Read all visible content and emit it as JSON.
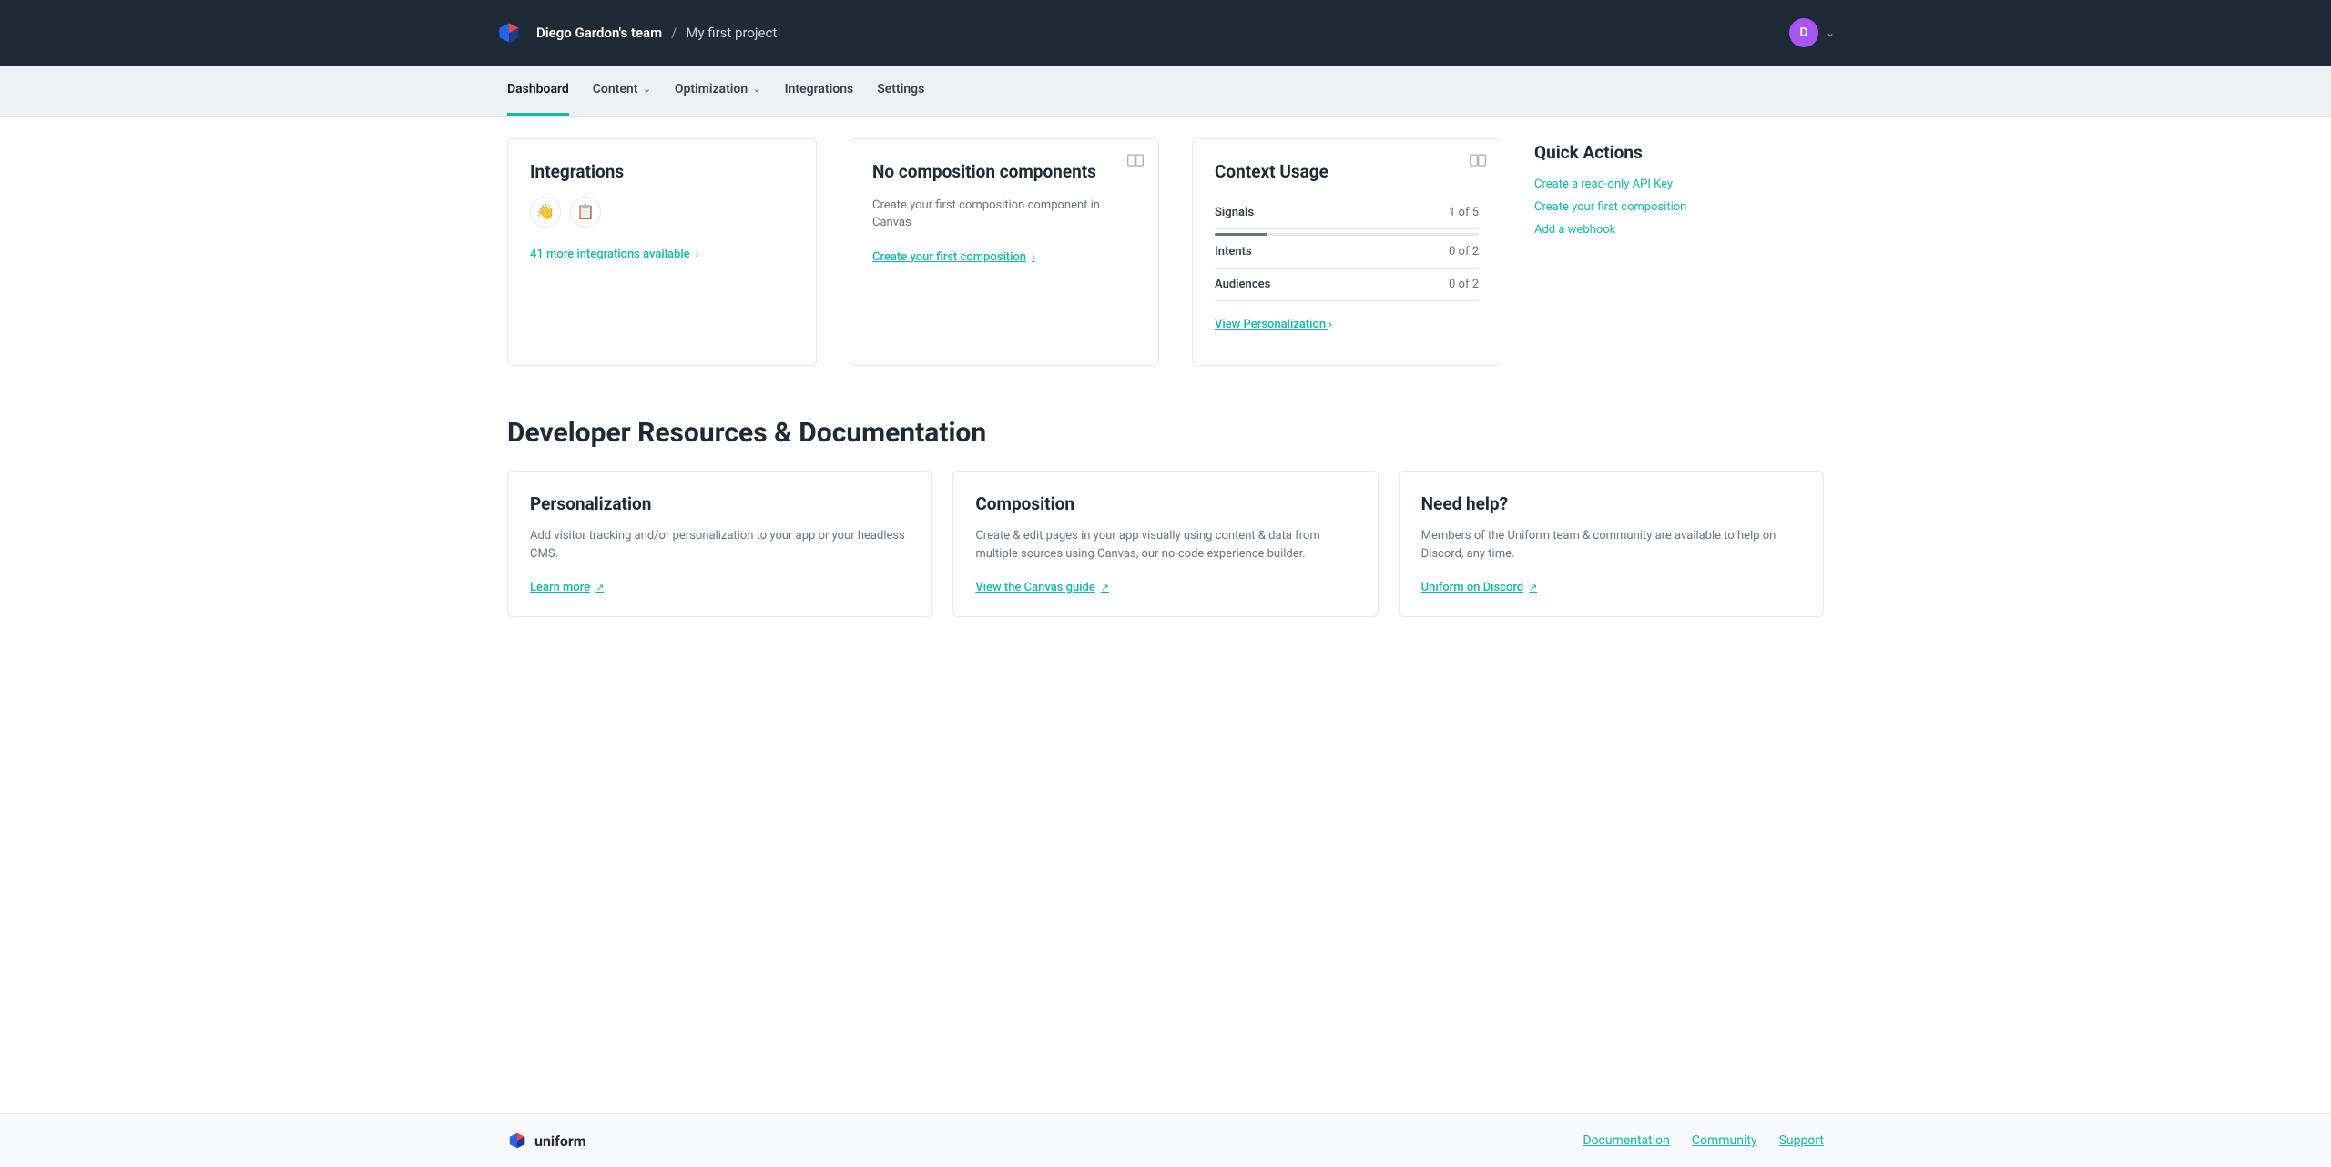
{
  "header": {
    "team": "Diego Gardon's team",
    "sep": "/",
    "project": "My first project",
    "avatar_initial": "D"
  },
  "nav": {
    "items": [
      {
        "label": "Dashboard",
        "dropdown": false,
        "active": true
      },
      {
        "label": "Content",
        "dropdown": true,
        "active": false
      },
      {
        "label": "Optimization",
        "dropdown": true,
        "active": false
      },
      {
        "label": "Integrations",
        "dropdown": false,
        "active": false
      },
      {
        "label": "Settings",
        "dropdown": false,
        "active": false
      }
    ]
  },
  "cards": {
    "integrations": {
      "title": "Integrations",
      "link": "41 more integrations available"
    },
    "composition": {
      "title": "No composition components",
      "desc": "Create your first composition component in Canvas",
      "link": "Create your first composition"
    },
    "context": {
      "title": "Context Usage",
      "rows": [
        {
          "label": "Signals",
          "val": "1 of 5",
          "pct": 20
        },
        {
          "label": "Intents",
          "val": "0 of 2",
          "pct": 0
        },
        {
          "label": "Audiences",
          "val": "0 of 2",
          "pct": 0
        }
      ],
      "link": "View Personalization"
    }
  },
  "quick_actions": {
    "title": "Quick Actions",
    "links": [
      "Create a read-only API Key",
      "Create your first composition",
      "Add a webhook"
    ]
  },
  "resources": {
    "title": "Developer Resources & Documentation",
    "cards": [
      {
        "title": "Personalization",
        "desc": "Add visitor tracking and/or personalization to your app or your headless CMS.",
        "link": "Learn more"
      },
      {
        "title": "Composition",
        "desc": "Create & edit pages in your app visually using content & data from multiple sources using Canvas, our no-code experience builder.",
        "link": "View the Canvas guide"
      },
      {
        "title": "Need help?",
        "desc": "Members of the Uniform team & community are available to help on Discord, any time.",
        "link": "Uniform on Discord"
      }
    ]
  },
  "footer": {
    "brand": "uniform",
    "links": [
      "Documentation",
      "Community",
      "Support"
    ]
  }
}
